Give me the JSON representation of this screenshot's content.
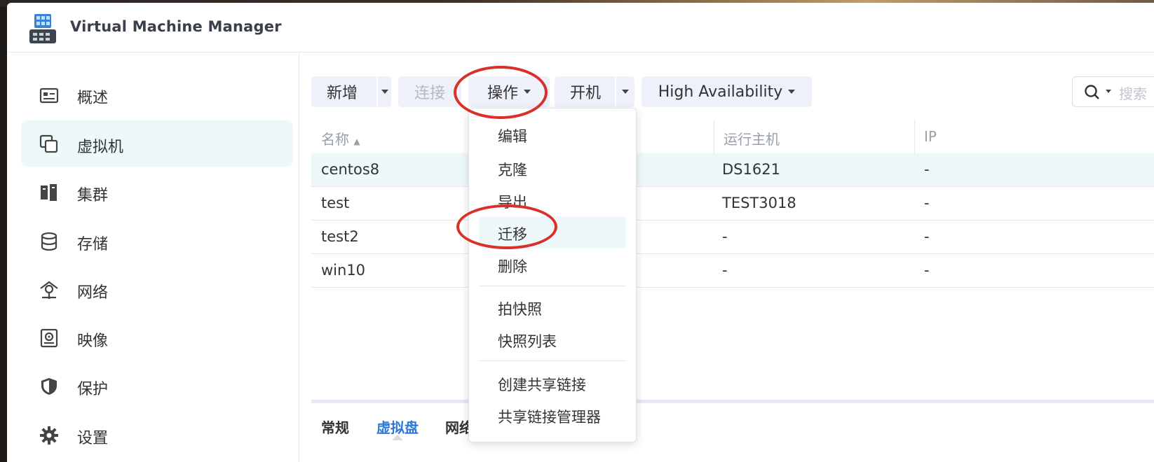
{
  "window": {
    "title": "Virtual Machine Manager"
  },
  "sidebar": {
    "items": [
      {
        "label": "概述",
        "icon": "overview-icon"
      },
      {
        "label": "虚拟机",
        "icon": "virtual-machine-icon",
        "active": true
      },
      {
        "label": "集群",
        "icon": "cluster-icon"
      },
      {
        "label": "存储",
        "icon": "storage-icon"
      },
      {
        "label": "网络",
        "icon": "network-icon"
      },
      {
        "label": "映像",
        "icon": "image-icon"
      },
      {
        "label": "保护",
        "icon": "shield-icon"
      },
      {
        "label": "设置",
        "icon": "gear-icon"
      }
    ]
  },
  "toolbar": {
    "add_label": "新增",
    "connect_label": "连接",
    "action_label": "操作",
    "power_on_label": "开机",
    "ha_label": "High Availability",
    "search_placeholder": "搜索"
  },
  "table": {
    "columns": [
      "名称",
      "运行主机",
      "IP"
    ],
    "rows": [
      {
        "name": "centos8",
        "host": "DS1621",
        "ip": "-"
      },
      {
        "name": "test",
        "host": "TEST3018",
        "ip": "-"
      },
      {
        "name": "test2",
        "host": "-",
        "ip": "-"
      },
      {
        "name": "win10",
        "host": "-",
        "ip": "-"
      }
    ]
  },
  "detail_tabs": [
    "常规",
    "虚拟盘",
    "网络"
  ],
  "action_menu": {
    "items": [
      "编辑",
      "克隆",
      "导出",
      "迁移",
      "删除",
      "拍快照",
      "快照列表",
      "创建共享链接",
      "共享链接管理器"
    ],
    "highlighted": "迁移"
  },
  "colors": {
    "accent": "#2e79d6",
    "annotation": "#d9302a",
    "selected_row": "#eef8fb"
  }
}
